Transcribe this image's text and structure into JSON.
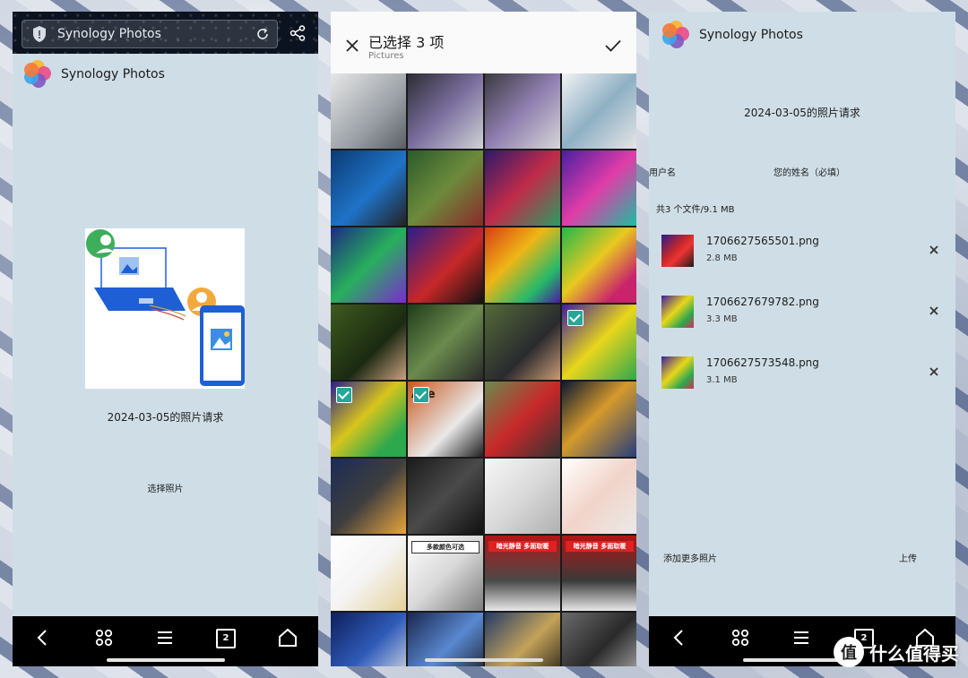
{
  "screen1": {
    "url_title": "Synology Photos",
    "brand_name": "Synology Photos",
    "request_title": "2024-03-05的照片请求",
    "select_photos": "选择照片",
    "tab_count": "2"
  },
  "screen2": {
    "title": "已选择 3 项",
    "subtitle": "Pictures",
    "selected_indices": [
      15,
      16,
      17
    ],
    "tile_labels": {
      "17": "Ace",
      "25": "多款颜色可选",
      "26": "暗光静音 多面取暖",
      "27": "暗光静音 多面取暖"
    }
  },
  "screen3": {
    "brand_name": "Synology Photos",
    "request_title": "2024-03-05的照片请求",
    "user_label": "用户名",
    "name_label": "您的姓名（必填）",
    "total": "共3 个文件/9.1 MB",
    "files": [
      {
        "name": "1706627565501.png",
        "size": "2.8 MB",
        "thumb": "red-phone"
      },
      {
        "name": "1706627679782.png",
        "size": "3.3 MB",
        "thumb": "colorful"
      },
      {
        "name": "1706627573548.png",
        "size": "3.1 MB",
        "thumb": "colorful"
      }
    ],
    "add_more": "添加更多照片",
    "upload": "上传",
    "tab_count": "2"
  },
  "watermark": {
    "badge": "值",
    "text": "什么值得买"
  },
  "icons": {
    "back": "back-icon",
    "apps": "apps-icon",
    "menu": "menu-icon",
    "tabs": "tabs-icon",
    "home": "home-icon",
    "share": "share-icon",
    "reload": "reload-icon",
    "shield": "shield-icon",
    "close": "close-icon",
    "confirm": "checkmark-icon",
    "remove": "remove-icon"
  },
  "colors": {
    "accent": "#27a69a",
    "panel": "#cfdee6",
    "illus_blue": "#1f5fd6",
    "illus_green": "#3dae5a"
  }
}
